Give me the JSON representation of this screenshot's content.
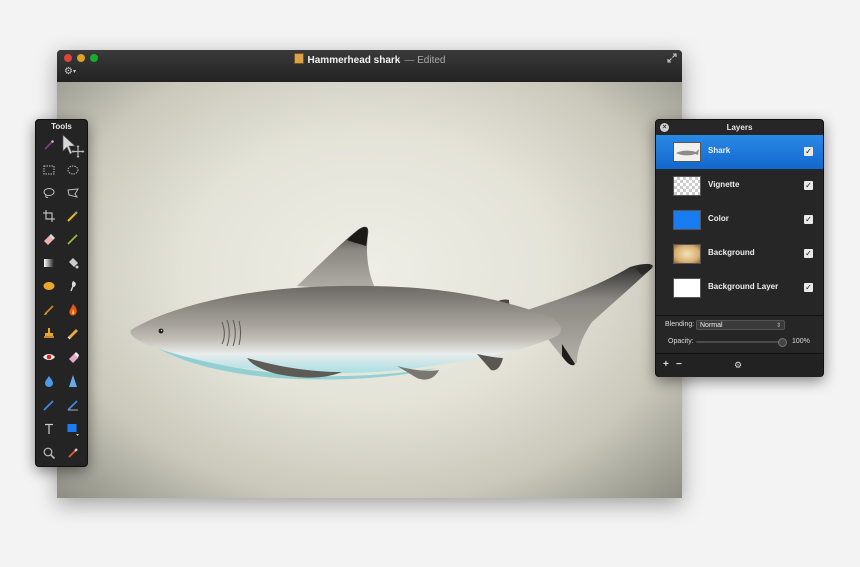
{
  "window": {
    "title": "Hammerhead shark",
    "separator": "—",
    "status": "Edited",
    "toolbar_gear": "⚙"
  },
  "tools_panel": {
    "title": "Tools",
    "tools": [
      "magic-wand",
      "move",
      "rect-select",
      "ellipse-select",
      "lasso",
      "polygon-lasso",
      "crop",
      "eyedropper",
      "eraser",
      "pencil",
      "gradient",
      "paint-bucket",
      "sponge",
      "smudge",
      "brush",
      "burn",
      "clone-stamp",
      "heal",
      "red-eye",
      "eraser-2",
      "blur",
      "sharpen",
      "pen",
      "vector-pen",
      "text",
      "shape",
      "zoom",
      "color-picker"
    ]
  },
  "layers_panel": {
    "title": "Layers",
    "layers": [
      {
        "name": "Shark",
        "visible": true,
        "selected": true,
        "thumb": "shark"
      },
      {
        "name": "Vignette",
        "visible": true,
        "selected": false,
        "thumb": "transparent"
      },
      {
        "name": "Color",
        "visible": true,
        "selected": false,
        "thumb": "#1a7cf2"
      },
      {
        "name": "Background",
        "visible": true,
        "selected": false,
        "thumb": "parchment"
      },
      {
        "name": "Background Layer",
        "visible": true,
        "selected": false,
        "thumb": "#ffffff"
      }
    ],
    "blending_label": "Blending:",
    "blending_value": "Normal",
    "opacity_label": "Opacity:",
    "opacity_value": "100%",
    "add_label": "+",
    "remove_label": "−",
    "gear_label": "⚙"
  },
  "colors": {
    "selection": "#1a72d8",
    "panel_bg": "#262626",
    "canvas_center": "#eeeee6",
    "canvas_edge": "#8d8d83"
  }
}
